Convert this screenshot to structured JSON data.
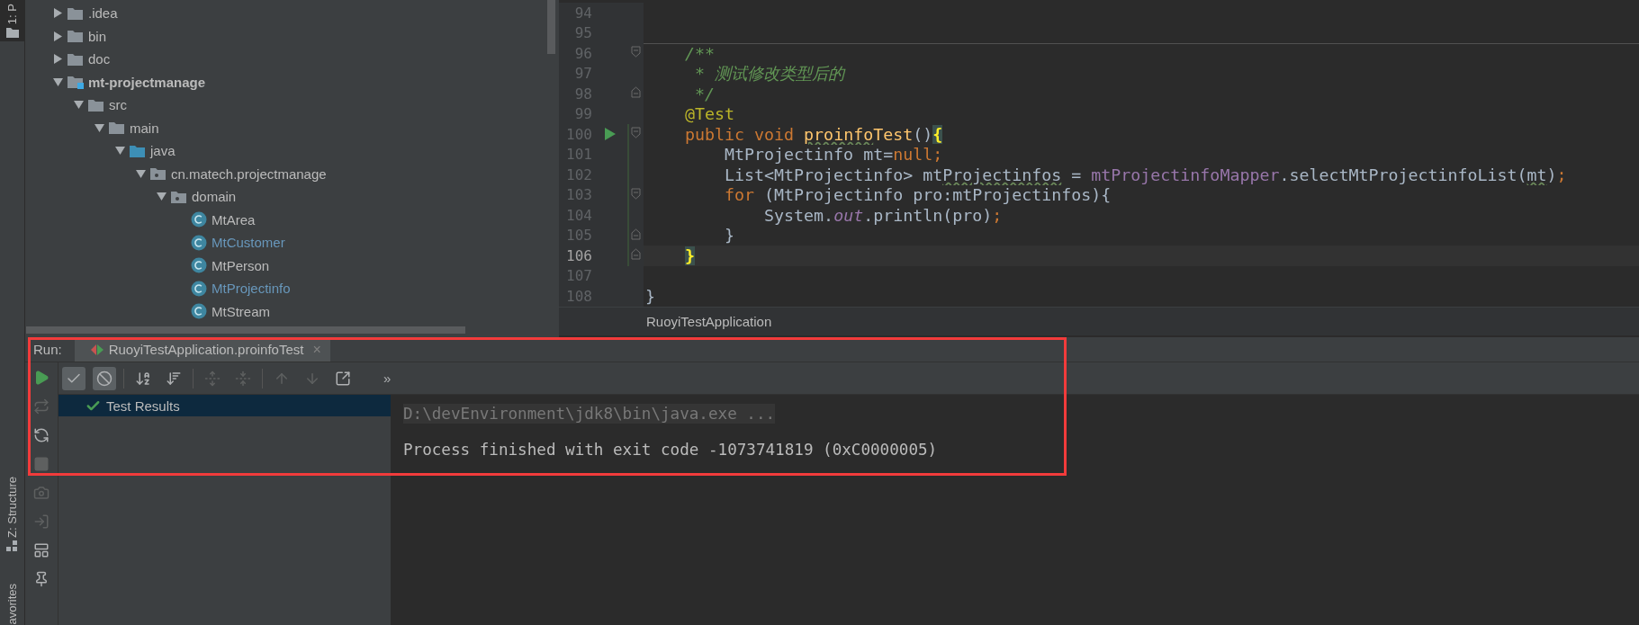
{
  "left_strip": {
    "project_tab": "1: P",
    "structure_tab": "Z: Structure",
    "favorites_tab": "avorites"
  },
  "project_tree": [
    {
      "label": ".idea",
      "kind": "folder",
      "expanded": false,
      "modified": false
    },
    {
      "label": "bin",
      "kind": "folder",
      "expanded": false,
      "modified": false
    },
    {
      "label": "doc",
      "kind": "folder",
      "expanded": false,
      "modified": false
    },
    {
      "label": "mt-projectmanage",
      "kind": "module",
      "expanded": true,
      "modified": false,
      "children": [
        {
          "label": "src",
          "kind": "folder",
          "expanded": true,
          "modified": false,
          "children": [
            {
              "label": "main",
              "kind": "folder",
              "expanded": true,
              "modified": false,
              "children": [
                {
                  "label": "java",
                  "kind": "source-root",
                  "expanded": true,
                  "modified": false,
                  "children": [
                    {
                      "label": "cn.matech.projectmanage",
                      "kind": "package",
                      "expanded": true,
                      "modified": false,
                      "children": [
                        {
                          "label": "domain",
                          "kind": "package",
                          "expanded": true,
                          "modified": false,
                          "children": [
                            {
                              "label": "MtArea",
                              "kind": "class",
                              "modified": false
                            },
                            {
                              "label": "MtCustomer",
                              "kind": "class",
                              "modified": true
                            },
                            {
                              "label": "MtPerson",
                              "kind": "class",
                              "modified": false
                            },
                            {
                              "label": "MtProjectinfo",
                              "kind": "class",
                              "modified": true
                            },
                            {
                              "label": "MtStream",
                              "kind": "class",
                              "modified": false
                            }
                          ]
                        }
                      ]
                    }
                  ]
                }
              ]
            }
          ]
        }
      ]
    }
  ],
  "editor": {
    "lines": [
      {
        "number": "94",
        "current": false,
        "runnable": false,
        "changed": false,
        "separator": false,
        "fold_start": false,
        "fold_end": false
      },
      {
        "number": "95",
        "current": false,
        "runnable": false,
        "changed": false,
        "separator": false,
        "fold_start": false,
        "fold_end": false
      },
      {
        "number": "96",
        "current": false,
        "runnable": false,
        "changed": false,
        "separator": true,
        "fold_start": true,
        "fold_end": false,
        "tokens": [
          {
            "kind": "comment",
            "text": "    /**"
          }
        ]
      },
      {
        "number": "97",
        "current": false,
        "runnable": false,
        "changed": false,
        "separator": false,
        "fold_start": false,
        "fold_end": false,
        "tokens": [
          {
            "kind": "comment",
            "text": "     * 测试修改类型后的"
          }
        ]
      },
      {
        "number": "98",
        "current": false,
        "runnable": false,
        "changed": false,
        "separator": false,
        "fold_start": false,
        "fold_end": true,
        "tokens": [
          {
            "kind": "comment",
            "text": "     */"
          }
        ]
      },
      {
        "number": "99",
        "current": false,
        "runnable": false,
        "changed": false,
        "separator": false,
        "fold_start": false,
        "fold_end": false,
        "tokens": [
          {
            "kind": "annotation",
            "text": "    @Test"
          }
        ]
      },
      {
        "number": "100",
        "current": false,
        "runnable": true,
        "changed": true,
        "separator": false,
        "fold_start": true,
        "fold_end": false,
        "tokens": [
          {
            "kind": "keyword",
            "text": "    public void "
          },
          {
            "kind": "method-warn",
            "text": "proinfo"
          },
          {
            "kind": "method",
            "text": "Test"
          },
          {
            "kind": "plain",
            "text": "()"
          },
          {
            "kind": "brace-match",
            "text": "{"
          }
        ]
      },
      {
        "number": "101",
        "current": false,
        "runnable": false,
        "changed": true,
        "separator": false,
        "fold_start": false,
        "fold_end": false,
        "tokens": [
          {
            "kind": "plain",
            "text": "        MtProjectinfo mt="
          },
          {
            "kind": "keyword",
            "text": "null;"
          }
        ]
      },
      {
        "number": "102",
        "current": false,
        "runnable": false,
        "changed": true,
        "separator": false,
        "fold_start": false,
        "fold_end": false,
        "tokens": [
          {
            "kind": "plain",
            "text": "        List<MtProjectinfo> mt"
          },
          {
            "kind": "plain-warn",
            "text": "Projectinfos"
          },
          {
            "kind": "plain",
            "text": " = "
          },
          {
            "kind": "field",
            "text": "mtProjectinfoMapper"
          },
          {
            "kind": "plain",
            "text": ".selectMtProjectinfoList("
          },
          {
            "kind": "plain-warn",
            "text": "mt"
          },
          {
            "kind": "plain",
            "text": ")"
          },
          {
            "kind": "keyword",
            "text": ";"
          }
        ]
      },
      {
        "number": "103",
        "current": false,
        "runnable": false,
        "changed": true,
        "separator": false,
        "fold_start": true,
        "fold_end": false,
        "tokens": [
          {
            "kind": "keyword",
            "text": "        for "
          },
          {
            "kind": "plain",
            "text": "(MtProjectinfo pro:mtProjectinfos){"
          }
        ]
      },
      {
        "number": "104",
        "current": false,
        "runnable": false,
        "changed": true,
        "separator": false,
        "fold_start": false,
        "fold_end": false,
        "tokens": [
          {
            "kind": "plain",
            "text": "            System."
          },
          {
            "kind": "static",
            "text": "out"
          },
          {
            "kind": "plain",
            "text": ".println(pro)"
          },
          {
            "kind": "keyword",
            "text": ";"
          }
        ]
      },
      {
        "number": "105",
        "current": false,
        "runnable": false,
        "changed": true,
        "separator": false,
        "fold_start": false,
        "fold_end": true,
        "tokens": [
          {
            "kind": "plain",
            "text": "        }"
          }
        ]
      },
      {
        "number": "106",
        "current": true,
        "runnable": false,
        "changed": true,
        "separator": false,
        "fold_start": false,
        "fold_end": true,
        "tokens": [
          {
            "kind": "brace-match",
            "text": "    }"
          }
        ]
      },
      {
        "number": "107",
        "current": false,
        "runnable": false,
        "changed": false,
        "separator": false,
        "fold_start": false,
        "fold_end": false
      },
      {
        "number": "108",
        "current": false,
        "runnable": false,
        "changed": false,
        "separator": false,
        "fold_start": false,
        "fold_end": false,
        "tokens": [
          {
            "kind": "plain",
            "text": "}"
          }
        ]
      }
    ],
    "breadcrumb": "RuoyiTestApplication"
  },
  "run_panel": {
    "label": "Run:",
    "highlighted": true,
    "tab": {
      "title": "RuoyiTestApplication.proinfoTest",
      "close": "×",
      "selected": true
    },
    "side_actions": [
      {
        "kind": "run",
        "disabled": false
      },
      {
        "kind": "rerun-failed",
        "disabled": true
      },
      {
        "kind": "auto-rerun",
        "disabled": false
      },
      {
        "kind": "stop",
        "disabled": true
      },
      {
        "kind": "camera",
        "disabled": true
      },
      {
        "kind": "import",
        "disabled": true
      },
      {
        "kind": "layout",
        "disabled": false
      },
      {
        "kind": "pin",
        "disabled": false
      }
    ],
    "toolbar": [
      {
        "kind": "show-passed",
        "on": true,
        "disabled": false
      },
      {
        "kind": "show-ignored",
        "on": true,
        "disabled": false
      },
      {
        "kind": "sort-alpha",
        "on": false,
        "disabled": false
      },
      {
        "kind": "sort-duration",
        "on": false,
        "disabled": false
      },
      {
        "kind": "expand-all",
        "on": false,
        "disabled": true
      },
      {
        "kind": "collapse-all",
        "on": false,
        "disabled": true
      },
      {
        "kind": "previous",
        "on": false,
        "disabled": true
      },
      {
        "kind": "next",
        "on": false,
        "disabled": true
      },
      {
        "kind": "export",
        "on": false,
        "disabled": false
      }
    ],
    "overflow": "»",
    "test_tree": [
      {
        "label": "Test Results",
        "passed": true,
        "selected": true
      }
    ],
    "console": [
      {
        "kind": "command",
        "text": "D:\\devEnvironment\\jdk8\\bin\\java.exe ..."
      },
      {
        "kind": "output",
        "text": "Process finished with exit code -1073741819 (0xC0000005)"
      }
    ]
  }
}
